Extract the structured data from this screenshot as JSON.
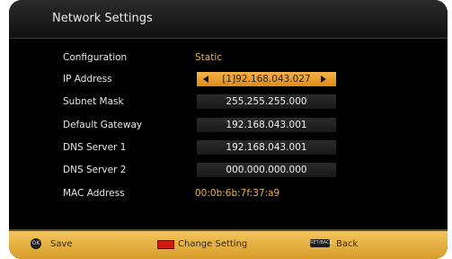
{
  "screen": {
    "title": "Network Settings"
  },
  "rows": [
    {
      "label": "Configuration",
      "value": "Static",
      "type": "plain"
    },
    {
      "label": "IP Address",
      "value": "[1]92.168.043.027",
      "type": "selected"
    },
    {
      "label": "Subnet Mask",
      "value": "255.255.255.000",
      "type": "field"
    },
    {
      "label": "Default Gateway",
      "value": "192.168.043.001",
      "type": "field"
    },
    {
      "label": "DNS Server 1",
      "value": "192.168.043.001",
      "type": "field"
    },
    {
      "label": "DNS Server 2",
      "value": "000.000.000.000",
      "type": "field"
    },
    {
      "label": "MAC Address",
      "value": "00:0b:6b:7f:37:a9",
      "type": "plain"
    }
  ],
  "footer": {
    "ok_icon_text": "OK",
    "ok_label": "Save",
    "red_label": "Change Setting",
    "back_icon_text": "RET/BACK",
    "back_label": "Back"
  },
  "colors": {
    "accent": "#e8a838",
    "value_text": "#e8b34a",
    "highlight": "#f0a030",
    "bottom_bar": "#e8b040",
    "red_key": "#d11a12"
  },
  "icons": {
    "left_arrow": "left-arrow-icon",
    "right_arrow": "right-arrow-icon",
    "ok": "ok-button-icon",
    "red_key": "red-key-icon",
    "back": "back-key-icon"
  }
}
